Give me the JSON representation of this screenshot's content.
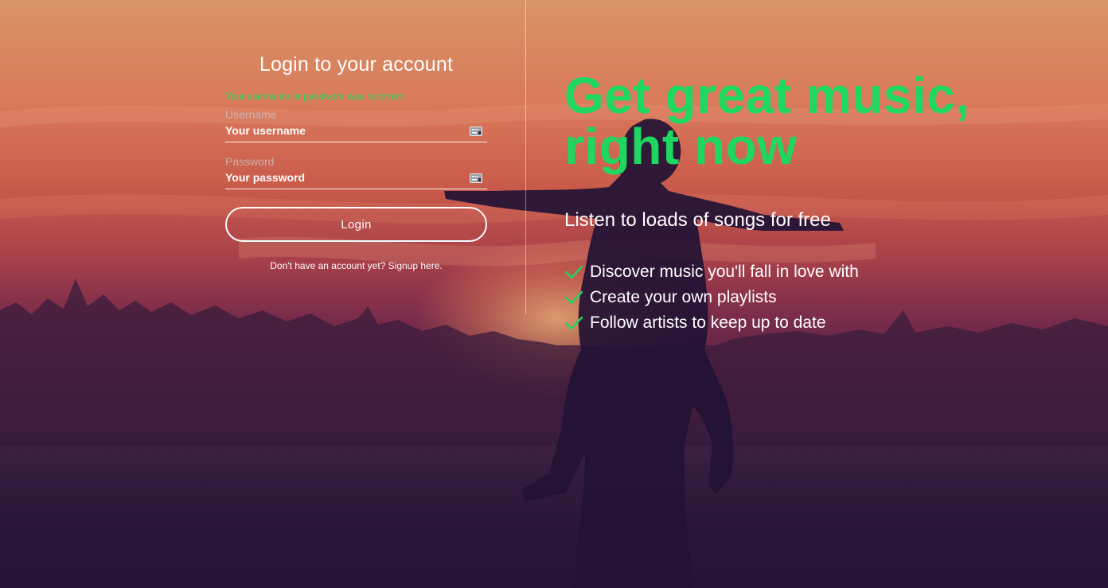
{
  "login": {
    "title": "Login to your account",
    "error": "Your username or password was incorrect",
    "username": {
      "label": "Username",
      "placeholder": "Your username",
      "value": ""
    },
    "password": {
      "label": "Password",
      "placeholder": "Your password",
      "value": ""
    },
    "submit_label": "Login",
    "signup_text": "Don't have an account yet? Signup here."
  },
  "hero": {
    "title_line1": "Get great music,",
    "title_line2": "right now",
    "subtitle": "Listen to loads of songs for free",
    "features": [
      "Discover music you'll fall in love with",
      "Create your own playlists",
      "Follow artists to keep up to date"
    ]
  },
  "colors": {
    "accent": "#1ed760",
    "text": "#ffffff"
  },
  "icons": {
    "field_icon": "keyboard-icon",
    "feature_icon": "check-icon"
  }
}
